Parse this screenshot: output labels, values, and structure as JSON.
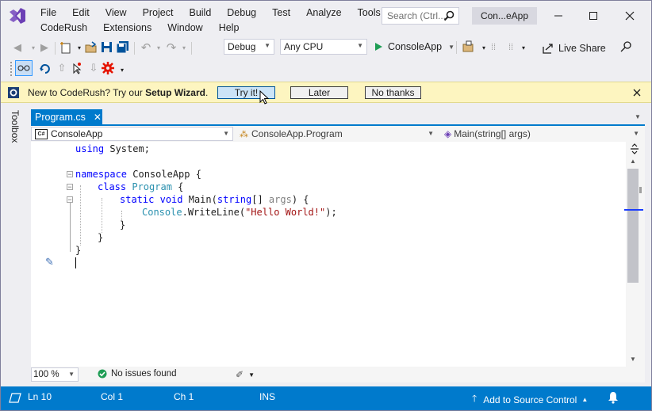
{
  "menu": {
    "row1": [
      "File",
      "Edit",
      "View",
      "Project",
      "Build",
      "Debug",
      "Test",
      "Analyze",
      "Tools"
    ],
    "row2": [
      "CodeRush",
      "Extensions",
      "Window",
      "Help"
    ]
  },
  "search": {
    "placeholder": "Search (Ctrl..."
  },
  "solution_name": "Con...eApp",
  "toolbar": {
    "config": "Debug",
    "platform": "Any CPU",
    "start_target": "ConsoleApp",
    "live_share": "Live Share"
  },
  "infobar": {
    "message_plain": "New to CodeRush? Try our ",
    "message_bold": "Setup Wizard",
    "message_end": ".",
    "try_it": "Try it!",
    "later": "Later",
    "no_thanks": "No thanks"
  },
  "toolbox_label": "Toolbox",
  "document_tab": {
    "label": "Program.cs",
    "close": "✕"
  },
  "navbar": {
    "project": "ConsoleApp",
    "type": "ConsoleApp.Program",
    "member": "Main(string[] args)"
  },
  "code": {
    "line1": {
      "kw": "using",
      "rest": " System;"
    },
    "line3": {
      "kw": "namespace",
      "rest": " ConsoleApp {"
    },
    "line4": {
      "kw": "class",
      "ty": "Program",
      "rest": " {"
    },
    "line5": {
      "kw1": "static",
      "kw2": "void",
      "name": "Main",
      "p1": "(",
      "kw3": "string",
      "p2": "[] ",
      "param": "args",
      "p3": ") {"
    },
    "line6": {
      "ty": "Console",
      "dot": ".",
      "method": "WriteLine",
      "open": "(",
      "str": "\"Hello World!\"",
      "close": ");"
    },
    "line7": "}",
    "line8": "}",
    "line9": "}"
  },
  "editor_footer": {
    "zoom": "100 %",
    "issues": "No issues found"
  },
  "status": {
    "line": "Ln 10",
    "col": "Col 1",
    "ch": "Ch 1",
    "mode": "INS",
    "source_control": "Add to Source Control"
  },
  "colors": {
    "accent": "#007acc",
    "infobar_bg": "#fdf5c0",
    "vs_purple": "#865fc5",
    "start_green": "#1f9d55"
  }
}
